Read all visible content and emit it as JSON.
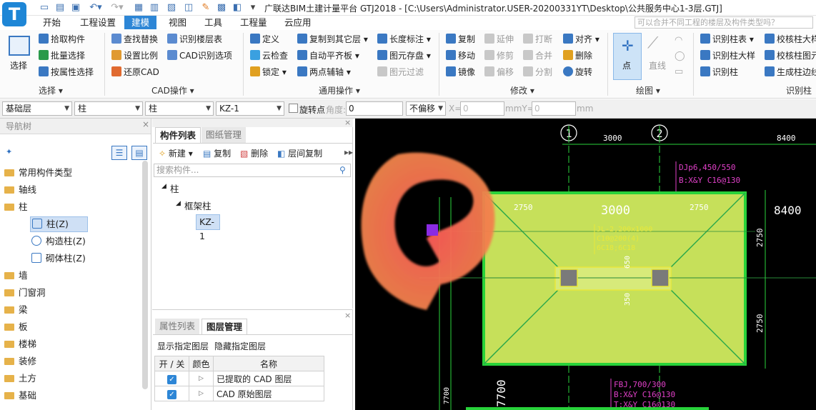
{
  "titlebar": {
    "title": "广联达BIM土建计量平台 GTJ2018 - [C:\\Users\\Administrator.USER-20200331YT\\Desktop\\公共服务中心1-3层.GTJ]",
    "logo_letter": "T"
  },
  "menu": {
    "items": [
      "开始",
      "工程设置",
      "建模",
      "视图",
      "工具",
      "工程量",
      "云应用"
    ],
    "active": "建模",
    "search_placeholder": "可以合并不同工程的楼层及构件类型吗？"
  },
  "ribbon": {
    "select": {
      "big_button": "选择",
      "items": [
        "拾取构件",
        "批量选择",
        "按属性选择"
      ],
      "group_label": "选择"
    },
    "cad": {
      "items": [
        "查找替换",
        "设置比例",
        "还原CAD",
        "识别楼层表",
        "CAD识别选项"
      ],
      "group_label": "CAD操作"
    },
    "common": {
      "items": [
        "定义",
        "云检查",
        "锁定",
        "复制到其它层",
        "自动平齐板",
        "两点辅轴",
        "长度标注",
        "图元存盘",
        "图元过滤"
      ],
      "group_label": "通用操作"
    },
    "modify": {
      "items": [
        "复制",
        "移动",
        "镜像",
        "延伸",
        "修剪",
        "偏移",
        "打断",
        "合并",
        "分割",
        "对齐",
        "删除",
        "旋转"
      ],
      "group_label": "修改"
    },
    "draw": {
      "items": [
        "点",
        "直线"
      ],
      "group_label": "绘图"
    },
    "recognize": {
      "items": [
        "识别柱表",
        "识别柱大样",
        "识别柱",
        "校核柱大样",
        "校核柱图元",
        "生成柱边线"
      ],
      "group_label": "识别柱"
    }
  },
  "filterbar": {
    "floor": "基础层",
    "type": "柱",
    "subtype": "柱",
    "component": "KZ-1",
    "rotate_label": "旋转点",
    "angle_label": "角度:",
    "angle_value": "0",
    "offset_option": "不偏移",
    "x_label": "X=",
    "x_value": "0",
    "mm_y_label": "mmY=",
    "y_value": "0",
    "mm_label": "mm"
  },
  "nav": {
    "header": "导航树",
    "items": [
      {
        "label": "常用构件类型",
        "level": 0
      },
      {
        "label": "轴线",
        "level": 0
      },
      {
        "label": "柱",
        "level": 0
      },
      {
        "label": "柱(Z)",
        "level": 1,
        "selected": true
      },
      {
        "label": "构造柱(Z)",
        "level": 1
      },
      {
        "label": "砌体柱(Z)",
        "level": 1
      },
      {
        "label": "墙",
        "level": 0
      },
      {
        "label": "门窗洞",
        "level": 0
      },
      {
        "label": "梁",
        "level": 0
      },
      {
        "label": "板",
        "level": 0
      },
      {
        "label": "楼梯",
        "level": 0
      },
      {
        "label": "装修",
        "level": 0
      },
      {
        "label": "土方",
        "level": 0
      },
      {
        "label": "基础",
        "level": 0
      }
    ]
  },
  "component_panel": {
    "tabs": [
      "构件列表",
      "图纸管理"
    ],
    "toolbar": [
      "新建",
      "复制",
      "删除",
      "层间复制"
    ],
    "search_placeholder": "搜索构件...",
    "tree": [
      {
        "label": "柱",
        "level": 0
      },
      {
        "label": "框架柱",
        "level": 1
      },
      {
        "label": "KZ-1",
        "level": 2
      }
    ]
  },
  "layer_panel": {
    "tabs": [
      "属性列表",
      "图层管理"
    ],
    "toolbar": [
      "显示指定图层",
      "隐藏指定图层"
    ],
    "columns": [
      "开 / 关",
      "颜色",
      "名称"
    ],
    "rows": [
      {
        "on": true,
        "name": "已提取的 CAD 图层"
      },
      {
        "on": true,
        "name": "CAD 原始图层"
      }
    ]
  },
  "canvas": {
    "axis_labels": [
      "1",
      "2"
    ],
    "dims": {
      "top_3000": "3000",
      "top_8400": "8400",
      "inner_2750_left": "2750",
      "inner_3000": "3000",
      "inner_2750_right": "2750",
      "right_8400": "8400",
      "right_2750_top": "2750",
      "right_2750_bottom": "2750",
      "left_7700": "7700",
      "left_7700_small": "7700",
      "h650": "650",
      "h350": "350"
    },
    "annotations": {
      "dj_line1": "DJp6,450/550",
      "dj_line2": "B:X&Y C16@130",
      "beam_line1": "JL-2,200x1000",
      "beam_line2": "C10@200(4)",
      "beam_line3": "6C18;6C18",
      "fbj_line1": "FBJ,700/300",
      "fbj_line2": "B:X&Y C16@130",
      "fbj_line3": "T:X&Y C16@130"
    },
    "colors": {
      "pad_fill": "#c6e05a",
      "pad_border": "#28d23a",
      "dim_line": "#2ad43c",
      "annotation_magenta": "#e040c8",
      "annotation_yellow": "#e8e83a",
      "column": "#7a7a7a",
      "cursor_marker": "#8a2be2"
    }
  }
}
